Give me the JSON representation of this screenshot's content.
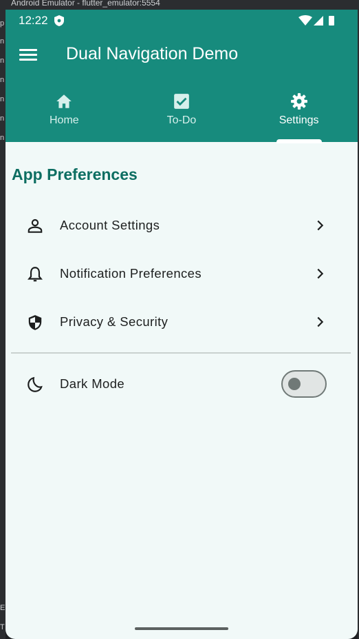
{
  "host": {
    "window_title": "Android Emulator - flutter_emulator:5554",
    "side_chars": [
      "p",
      "n",
      "n",
      "n",
      "n",
      "n",
      "n",
      "E",
      "T"
    ]
  },
  "status": {
    "time": "12:22"
  },
  "appbar": {
    "title": "Dual Navigation Demo",
    "menu_icon": "hamburger-menu-icon"
  },
  "tabs": [
    {
      "label": "Home",
      "icon": "home-icon",
      "active": false
    },
    {
      "label": "To-Do",
      "icon": "checkbox-icon",
      "active": false
    },
    {
      "label": "Settings",
      "icon": "gear-icon",
      "active": true
    }
  ],
  "main": {
    "section_title": "App Preferences",
    "items": [
      {
        "label": "Account Settings",
        "icon": "person-icon"
      },
      {
        "label": "Notification Preferences",
        "icon": "bell-icon"
      },
      {
        "label": "Privacy & Security",
        "icon": "shield-icon"
      }
    ],
    "dark_mode": {
      "label": "Dark Mode",
      "icon": "moon-icon",
      "enabled": false
    }
  },
  "colors": {
    "primary": "#178b7d",
    "section_title": "#0d6e62",
    "background": "#f1f9f8",
    "text": "#1d1f1f"
  }
}
